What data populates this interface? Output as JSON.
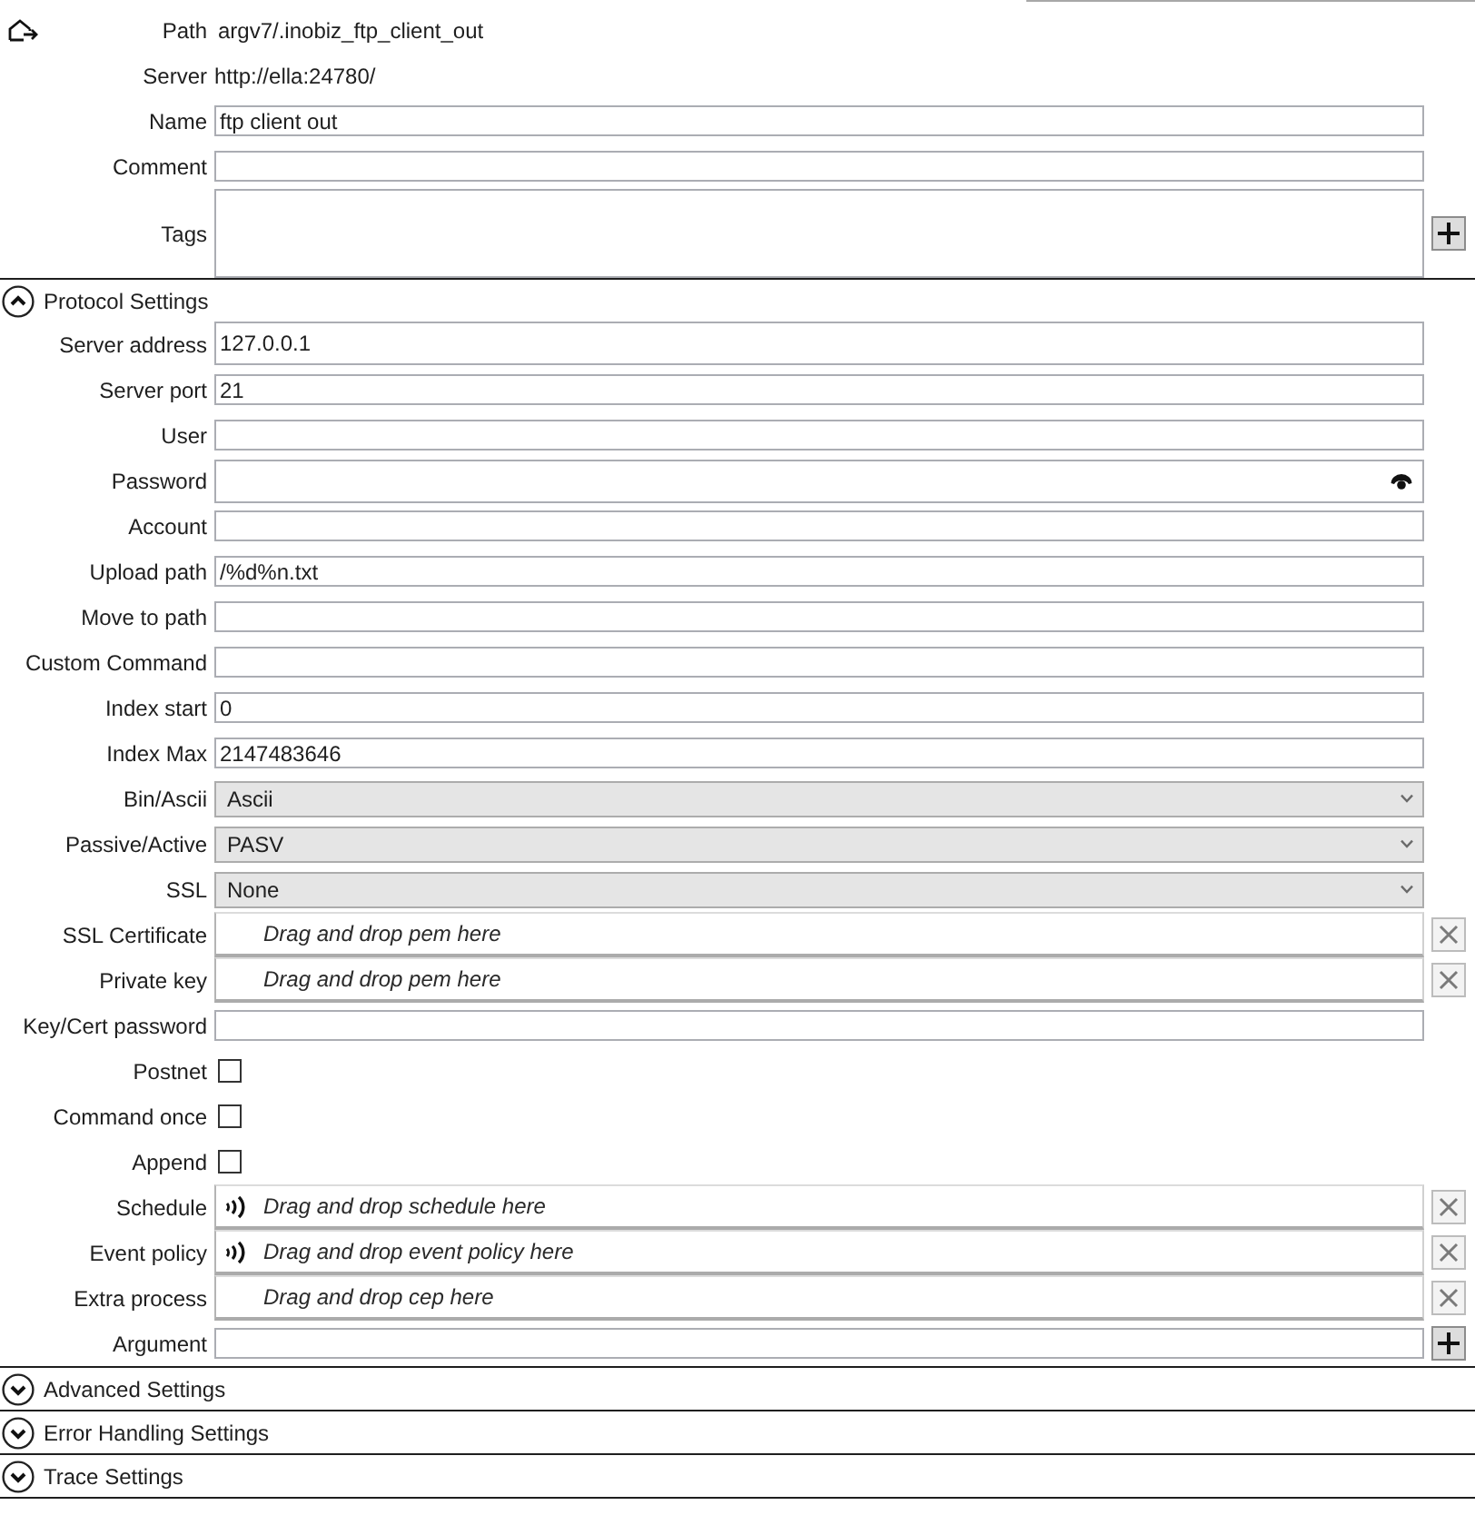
{
  "header": {
    "path_label": "Path",
    "path": "argv7/.inobiz_ftp_client_out",
    "server_label": "Server",
    "server": "http://ella:24780/"
  },
  "general": [
    {
      "kind": "text",
      "label": "Name",
      "value": "ftp client out"
    },
    {
      "kind": "text",
      "label": "Comment"
    },
    {
      "kind": "tags",
      "label": "Tags"
    }
  ],
  "sections": [
    {
      "title": "Protocol Settings",
      "expanded": true,
      "fields": [
        {
          "kind": "text",
          "label": "Server address",
          "value": "127.0.0.1",
          "tall": true
        },
        {
          "kind": "text",
          "label": "Server port",
          "value": "21"
        },
        {
          "kind": "text",
          "label": "User"
        },
        {
          "kind": "password",
          "label": "Password",
          "tall": true
        },
        {
          "kind": "text",
          "label": "Account"
        },
        {
          "kind": "text",
          "label": "Upload path",
          "value": "/%d%n.txt"
        },
        {
          "kind": "text",
          "label": "Move to path"
        },
        {
          "kind": "text",
          "label": "Custom Command"
        },
        {
          "kind": "text",
          "label": "Index start",
          "value": "0"
        },
        {
          "kind": "text",
          "label": "Index Max",
          "value": "2147483646"
        },
        {
          "kind": "select",
          "label": "Bin/Ascii",
          "value": "Ascii"
        },
        {
          "kind": "select",
          "label": "Passive/Active",
          "value": "PASV"
        },
        {
          "kind": "select",
          "label": "SSL",
          "value": "None"
        },
        {
          "kind": "drop",
          "label": "SSL Certificate",
          "hint": "Drag and drop pem here",
          "linked": false
        },
        {
          "kind": "drop",
          "label": "Private key",
          "hint": "Drag and drop pem here",
          "linked": false
        },
        {
          "kind": "text",
          "label": "Key/Cert password"
        },
        {
          "kind": "checkbox",
          "label": "Postnet",
          "checked": false
        },
        {
          "kind": "checkbox",
          "label": "Command once",
          "checked": false
        },
        {
          "kind": "checkbox",
          "label": "Append",
          "checked": false
        },
        {
          "kind": "drop",
          "label": "Schedule",
          "hint": "Drag and drop schedule here",
          "linked": true
        },
        {
          "kind": "drop",
          "label": "Event policy",
          "hint": "Drag and drop event policy here",
          "linked": true
        },
        {
          "kind": "drop",
          "label": "Extra process",
          "hint": "Drag and drop cep here",
          "linked": false
        },
        {
          "kind": "list",
          "label": "Argument"
        }
      ]
    },
    {
      "title": "Advanced Settings",
      "expanded": false
    },
    {
      "title": "Error Handling Settings",
      "expanded": false
    },
    {
      "title": "Trace Settings",
      "expanded": false
    }
  ]
}
